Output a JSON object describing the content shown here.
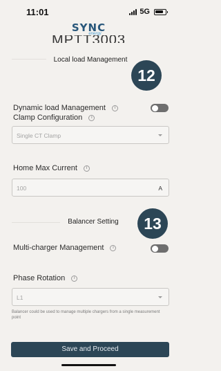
{
  "status_bar": {
    "time": "11:01",
    "network": "5G"
  },
  "logo": {
    "main": "SYNC",
    "sub": "energy",
    "color": "#27567a"
  },
  "header": {
    "partial_title": "MPTT3003"
  },
  "local_load": {
    "section_title": "Local load Management",
    "step_number": "12",
    "dynamic_load_label": "Dynamic load Management",
    "dynamic_load_enabled": false,
    "clamp_label": "Clamp Configuration",
    "clamp_value": "Single CT Clamp",
    "home_max_label": "Home Max Current",
    "home_max_placeholder": "100",
    "home_max_unit": "A"
  },
  "balancer": {
    "section_title": "Balancer Setting",
    "step_number": "13",
    "multi_charger_label": "Multi-charger Management",
    "multi_charger_enabled": false,
    "phase_label": "Phase Rotation",
    "phase_value": "L1",
    "helper_text": "Balancer could be used to manage multiple chargers from a single measurement point"
  },
  "actions": {
    "save_label": "Save and Proceed"
  },
  "colors": {
    "primary": "#2c4656",
    "background": "#f3f1ee",
    "toggle_off": "#6e6e6e"
  }
}
